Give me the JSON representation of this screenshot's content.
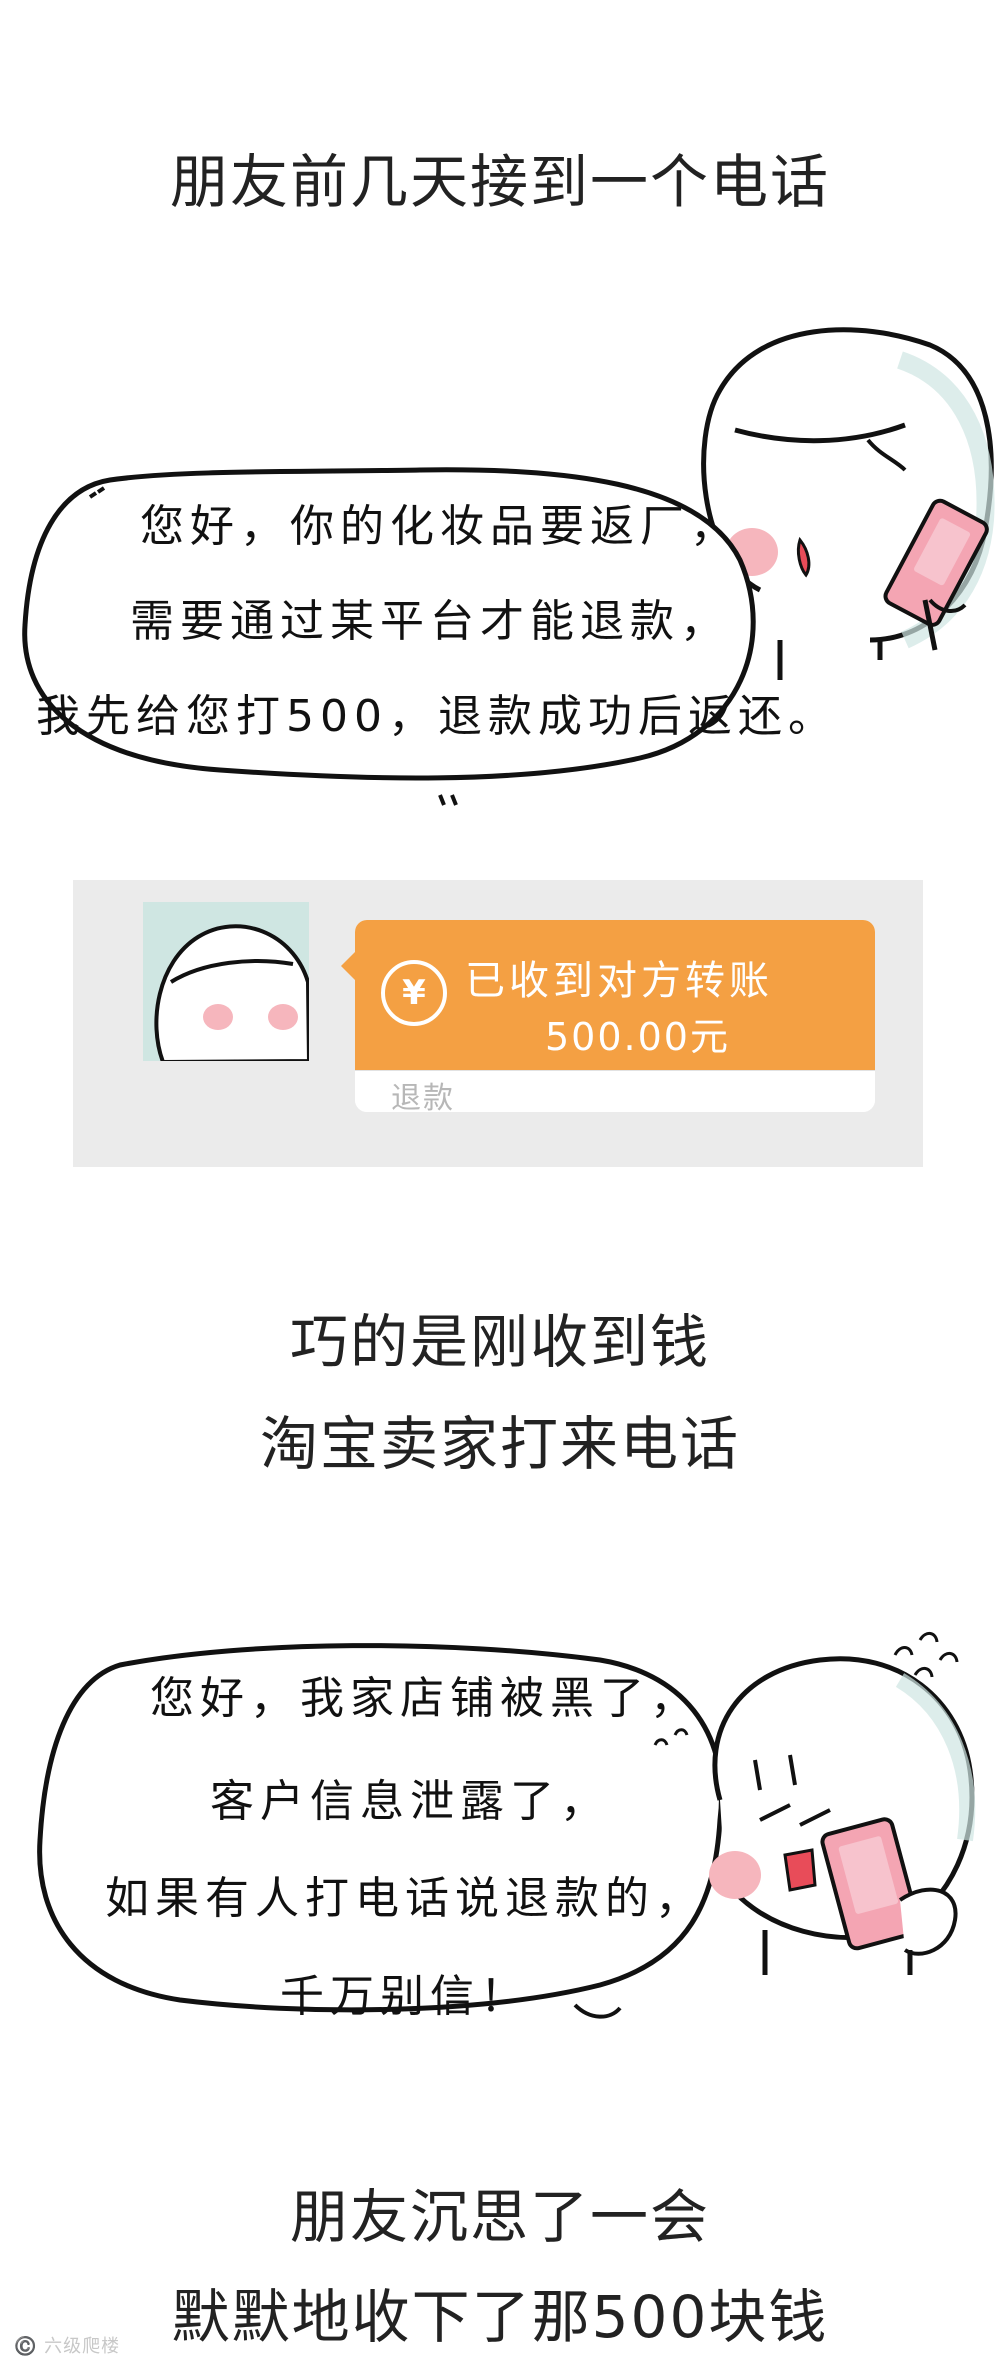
{
  "captions": {
    "c1": "朋友前几天接到一个电话",
    "c2a": "巧的是刚收到钱",
    "c2b": "淘宝卖家打来电话",
    "c3a": "朋友沉思了一会",
    "c3b": "默默地收下了那500块钱"
  },
  "bubble1": {
    "line1": "您好，你的化妆品要返厂，",
    "line2": "需要通过某平台才能退款，",
    "line3": "我先给您打500，退款成功后返还。"
  },
  "transfer": {
    "icon": "¥",
    "title": "已收到对方转账",
    "amount": "500.00元",
    "note": "退款"
  },
  "bubble2": {
    "line1": "您好，我家店铺被黑了，",
    "line2": "客户信息泄露了，",
    "line3": "如果有人打电话说退款的，",
    "line4": "千万别信！"
  },
  "watermark": "©️ 六级爬楼"
}
